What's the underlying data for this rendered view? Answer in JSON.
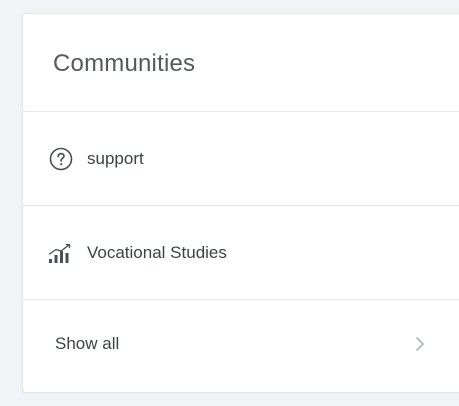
{
  "communities": {
    "title": "Communities",
    "items": [
      {
        "label": "support",
        "icon": "question-circle-icon"
      },
      {
        "label": "Vocational Studies",
        "icon": "signal-bars-icon"
      }
    ],
    "show_all_label": "Show all",
    "show_all_icon": "chevron-right-icon"
  },
  "colors": {
    "page_background": "#f1f3f6",
    "card_background": "#ffffff",
    "text_primary": "#3d4247",
    "text_heading": "#55595e",
    "icon": "#4a4f55",
    "chevron": "#b0b4b9"
  }
}
